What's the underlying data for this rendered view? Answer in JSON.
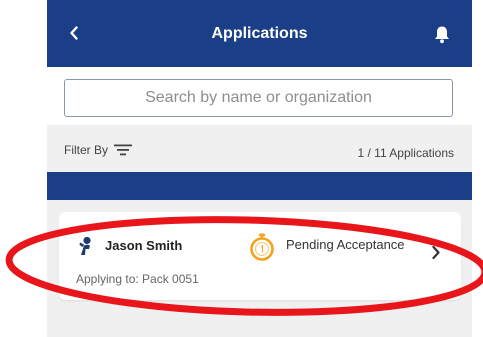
{
  "header": {
    "title": "Applications",
    "back_icon": "chevron-left-icon",
    "bell_icon": "bell-icon"
  },
  "search": {
    "placeholder": "Search by name or organization",
    "value": ""
  },
  "filter": {
    "label": "Filter By",
    "icon": "filter-icon",
    "count_text": "1 / 11 Applications"
  },
  "application": {
    "name": "Jason Smith",
    "status": "Pending Acceptance",
    "applying_to": "Applying to:  Pack 0051",
    "person_icon": "person-icon",
    "status_icon": "timer-icon",
    "chevron_icon": "chevron-right-icon"
  },
  "colors": {
    "brand": "#1b3f86",
    "status_orange": "#f3a31b",
    "highlight_red": "#e8161b"
  }
}
